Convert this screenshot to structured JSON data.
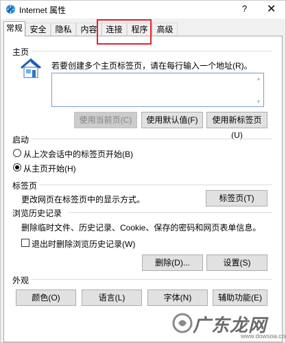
{
  "window": {
    "title": "Internet 属性",
    "help_glyph": "?",
    "close_glyph": "✕"
  },
  "tabs": [
    {
      "label": "常规",
      "active": true
    },
    {
      "label": "安全"
    },
    {
      "label": "隐私"
    },
    {
      "label": "内容"
    },
    {
      "label": "连接"
    },
    {
      "label": "程序"
    },
    {
      "label": "高级"
    }
  ],
  "home": {
    "group_label": "主页",
    "description": "若要创建多个主页标签页，请在每行输入一个地址(R)。",
    "textarea_value": "",
    "buttons": {
      "use_current": "使用当前页(C)",
      "use_default": "使用默认值(F)",
      "use_new_tab": "使用新标签页(U)"
    }
  },
  "startup": {
    "group_label": "启动",
    "options": [
      {
        "label": "从上次会话中的标签页开始(B)",
        "selected": false
      },
      {
        "label": "从主页开始(H)",
        "selected": true
      }
    ]
  },
  "tabs_section": {
    "group_label": "标签页",
    "description": "更改网页在标签页中的显示方式。",
    "button": "标签页(T)"
  },
  "history": {
    "group_label": "浏览历史记录",
    "description": "删除临时文件、历史记录、Cookie、保存的密码和网页表单信息。",
    "checkbox_label": "退出时删除浏览历史记录(W)",
    "checkbox_checked": false,
    "delete_button": "删除(D)...",
    "settings_button": "设置(S)"
  },
  "appearance": {
    "group_label": "外观",
    "buttons": {
      "colors": "颜色(O)",
      "languages": "语言(L)",
      "fonts": "字体(N)",
      "accessibility": "辅助功能(E)"
    }
  },
  "watermark": {
    "brand": "广东龙网",
    "url": "www.dowsoa.com"
  },
  "colors": {
    "highlight": "#e8202a",
    "textarea_border": "#7a9cc6"
  }
}
